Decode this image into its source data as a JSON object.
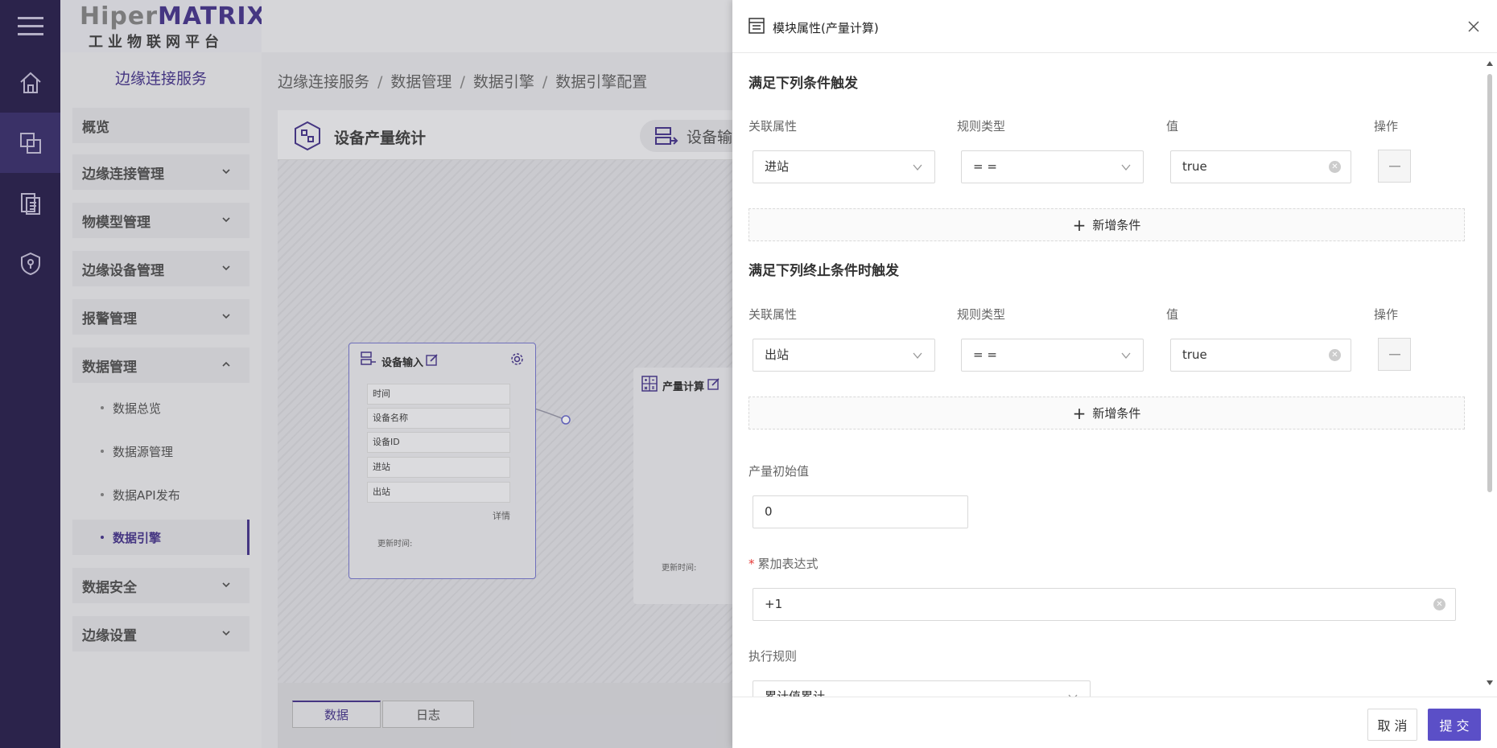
{
  "brand": {
    "name_prefix": "Hiper",
    "name_suffix": "MATRIX",
    "subtitle": "工业物联网平台"
  },
  "sidebar": {
    "title": "边缘连接服务",
    "items": [
      {
        "label": "概览"
      },
      {
        "label": "边缘连接管理"
      },
      {
        "label": "物模型管理"
      },
      {
        "label": "边缘设备管理"
      },
      {
        "label": "报警管理"
      },
      {
        "label": "数据管理"
      }
    ],
    "data_sub": [
      {
        "label": "数据总览"
      },
      {
        "label": "数据源管理"
      },
      {
        "label": "数据API发布"
      },
      {
        "label": "数据引擎"
      }
    ],
    "items_after": [
      {
        "label": "数据安全"
      },
      {
        "label": "边缘设置"
      }
    ]
  },
  "breadcrumb": [
    "边缘连接服务",
    "数据管理",
    "数据引擎",
    "数据引擎配置"
  ],
  "canvas": {
    "title": "设备产量统计",
    "chip": "设备输入",
    "node1": {
      "title": "设备输入",
      "fields": [
        "时间",
        "设备名称",
        "设备ID",
        "进站",
        "出站"
      ],
      "detail": "详情",
      "updated": "更新时间:"
    },
    "node2": {
      "title": "产量计算",
      "updated": "更新时间:"
    }
  },
  "bottom_tabs": [
    "数据",
    "日志"
  ],
  "drawer": {
    "title": "模块属性(产量计算)",
    "start": {
      "title": "满足下列条件触发",
      "col_attr": "关联属性",
      "col_rule": "规则类型",
      "col_value": "值",
      "col_op": "操作",
      "attr": "进站",
      "rule": "= =",
      "value": "true",
      "add": "新增条件"
    },
    "stop": {
      "title": "满足下列终止条件时触发",
      "col_attr": "关联属性",
      "col_rule": "规则类型",
      "col_value": "值",
      "col_op": "操作",
      "attr": "出站",
      "rule": "= =",
      "value": "true",
      "add": "新增条件"
    },
    "initial": {
      "label": "产量初始值",
      "value": "0"
    },
    "expr": {
      "label": "累加表达式",
      "value": "+1"
    },
    "exec": {
      "label": "执行规则",
      "value": "累计值累计"
    },
    "cancel": "取 消",
    "submit": "提 交"
  },
  "colors": {
    "accent": "#4b3a8f",
    "primary_btn": "#5b4fc7"
  }
}
